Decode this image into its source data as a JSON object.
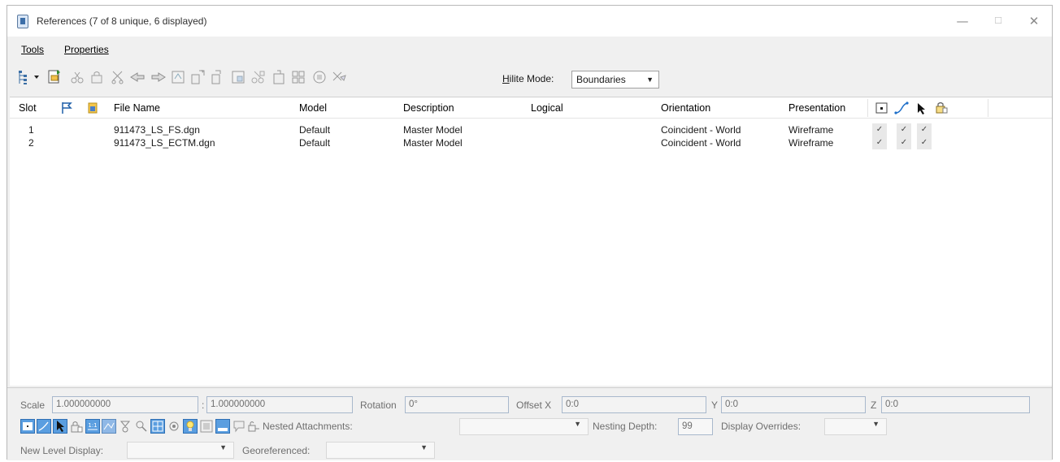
{
  "window": {
    "title": "References (7 of 8 unique, 6 displayed)",
    "minimize": "—",
    "maximize": "☐",
    "close": "✕"
  },
  "menu": {
    "tools": "Tools",
    "properties": "Properties"
  },
  "toolbar": {
    "hilite_label_underlined": "H",
    "hilite_label_rest": "ilite Mode:",
    "hilite_value": "Boundaries"
  },
  "table": {
    "columns": {
      "slot": "Slot",
      "file_name": "File Name",
      "model": "Model",
      "description": "Description",
      "logical": "Logical",
      "orientation": "Orientation",
      "presentation": "Presentation"
    },
    "rows": [
      {
        "slot": "1",
        "file": "911473_LS_FS.dgn",
        "model": "Default",
        "description": "Master Model",
        "logical": "",
        "orientation": "Coincident - World",
        "presentation": "Wireframe",
        "display": "✓",
        "snap": "✓",
        "locate": "✓"
      },
      {
        "slot": "2",
        "file": "911473_LS_ECTM.dgn",
        "model": "Default",
        "description": "Master Model",
        "logical": "",
        "orientation": "Coincident - World",
        "presentation": "Wireframe",
        "display": "✓",
        "snap": "✓",
        "locate": "✓"
      }
    ]
  },
  "settings": {
    "scale_label": "Scale",
    "scale_a": "1.000000000",
    "scale_sep": ":",
    "scale_b": "1.000000000",
    "rotation_label": "Rotation",
    "rotation": "0°",
    "offset_x_label": "Offset X",
    "offset_x": "0:0",
    "y_label": "Y",
    "offset_y": "0:0",
    "z_label": "Z",
    "offset_z": "0:0",
    "nested_label": "Nested Attachments:",
    "nested_value": "",
    "nesting_depth_label": "Nesting Depth:",
    "nesting_depth": "99",
    "display_overrides_label": "Display Overrides:",
    "new_level_label": "New Level Display:",
    "georeferenced_label": "Georeferenced:"
  },
  "colors": {
    "accent": "#1e6fc9",
    "field_border": "#a8b8cc"
  }
}
